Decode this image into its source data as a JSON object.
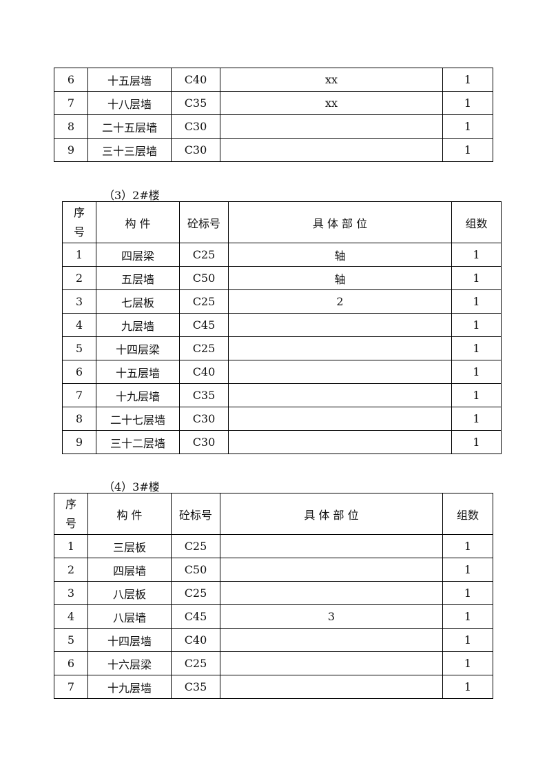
{
  "header": {
    "seq": "序号",
    "component": "构 件",
    "grade": "砼标号",
    "location": "具 体 部 位",
    "groups": "组数"
  },
  "table1": {
    "rows": [
      {
        "seq": "6",
        "component": "十五层墙",
        "grade": "C40",
        "location": "xx",
        "groups": "1"
      },
      {
        "seq": "7",
        "component": "十八层墙",
        "grade": "C35",
        "location": "xx",
        "groups": "1"
      },
      {
        "seq": "8",
        "component": "二十五层墙",
        "grade": "C30",
        "location": "",
        "groups": "1"
      },
      {
        "seq": "9",
        "component": "三十三层墙",
        "grade": "C30",
        "location": "",
        "groups": "1"
      }
    ]
  },
  "table2": {
    "caption": "（3）2#楼",
    "rows": [
      {
        "seq": "1",
        "component": "四层梁",
        "grade": "C25",
        "location": "轴",
        "groups": "1"
      },
      {
        "seq": "2",
        "component": "五层墙",
        "grade": "C50",
        "location": "轴",
        "groups": "1"
      },
      {
        "seq": "3",
        "component": "七层板",
        "grade": "C25",
        "location": "2",
        "groups": "1"
      },
      {
        "seq": "4",
        "component": "九层墙",
        "grade": "C45",
        "location": "",
        "groups": "1"
      },
      {
        "seq": "5",
        "component": "十四层梁",
        "grade": "C25",
        "location": "",
        "groups": "1"
      },
      {
        "seq": "6",
        "component": "十五层墙",
        "grade": "C40",
        "location": "",
        "groups": "1"
      },
      {
        "seq": "7",
        "component": "十九层墙",
        "grade": "C35",
        "location": "",
        "groups": "1"
      },
      {
        "seq": "8",
        "component": "二十七层墙",
        "grade": "C30",
        "location": "",
        "groups": "1"
      },
      {
        "seq": "9",
        "component": "三十二层墙",
        "grade": "C30",
        "location": "",
        "groups": "1"
      }
    ]
  },
  "table3": {
    "caption": "（4）3#楼",
    "rows": [
      {
        "seq": "1",
        "component": "三层板",
        "grade": "C25",
        "location": "",
        "groups": "1"
      },
      {
        "seq": "2",
        "component": "四层墙",
        "grade": "C50",
        "location": "",
        "groups": "1"
      },
      {
        "seq": "3",
        "component": "八层板",
        "grade": "C25",
        "location": "",
        "groups": "1"
      },
      {
        "seq": "4",
        "component": "八层墙",
        "grade": "C45",
        "location": "3",
        "groups": "1"
      },
      {
        "seq": "5",
        "component": "十四层墙",
        "grade": "C40",
        "location": "",
        "groups": "1"
      },
      {
        "seq": "6",
        "component": "十六层梁",
        "grade": "C25",
        "location": "",
        "groups": "1"
      },
      {
        "seq": "7",
        "component": "十九层墙",
        "grade": "C35",
        "location": "",
        "groups": "1"
      }
    ]
  }
}
